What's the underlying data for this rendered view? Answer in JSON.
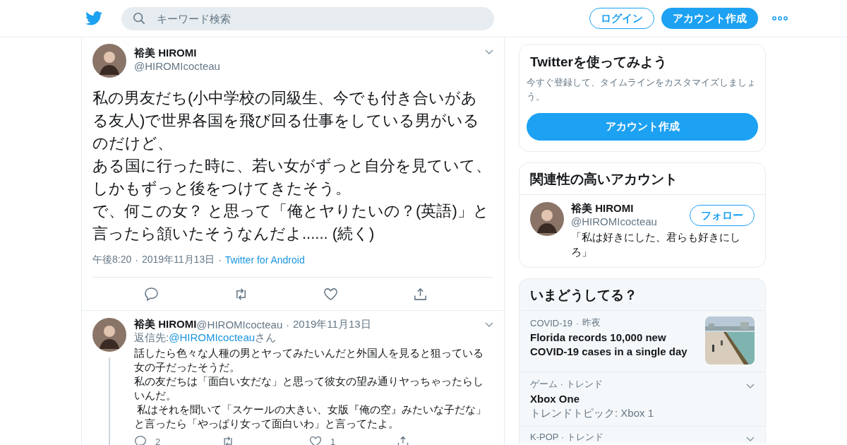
{
  "header": {
    "search": {
      "placeholder": "キーワード検索"
    },
    "login": "ログイン",
    "signup": "アカウント作成"
  },
  "tweet": {
    "name": "裕美 HIROMI",
    "handle": "@HIROMIcocteau",
    "paragraphs": [
      "私の男友だち(小中学校の同級生、今でも付き合いがある友人)で世界各国を飛び回る仕事をしている男がいるのだけど、",
      "ある国に行った時に、若い女がずっと自分を見ていて、しかもずっと後をつけてきたそう。",
      "で、何この女？ と思って「俺とヤりたいの？(英語)」と言ったら頷いたそうなんだよ...... (続く)"
    ],
    "time": "午後8:20",
    "separator": "·",
    "date": "2019年11月13日",
    "separator_2": "·",
    "source": "Twitter for Android"
  },
  "reply": {
    "name": "裕美 HIROMI",
    "handle": "@HIROMIcocteau",
    "separator": "·",
    "date": "2019年11月13日",
    "reply_to_label": "返信先:",
    "reply_to_handle": "@HIROMIcocteau",
    "reply_to_suffix": "さん",
    "paragraphs": [
      "話したら色々な人種の男とヤってみたいんだと外国人を見ると狙っている女の子だったそうだ。",
      "私の友だちは「面白い女だな」と思って彼女の望み通りヤっちゃったらしいんだ。",
      " 私はそれを聞いて「スケールの大きい、女版『俺の空』みたいな子だな」と言ったら「やっぱり女って面白いわ」と言ってたよ。"
    ],
    "reply_count": "2",
    "like_count": "1"
  },
  "signup_card": {
    "title": "Twitterを使ってみよう",
    "text": "今すぐ登録して、タイムラインをカスタマイズしましょう。",
    "button": "アカウント作成"
  },
  "related": {
    "title": "関連性の高いアカウント",
    "account": {
      "name": "裕美 HIROMI",
      "handle": "@HIROMIcocteau",
      "bio": "「私は好きにした、君らも好きにしろ」",
      "follow": "フォロー"
    }
  },
  "trends": {
    "title": "いまどうしてる？",
    "items": [
      {
        "kind": "news",
        "category": "COVID-19",
        "separator": "·",
        "time": "昨夜",
        "title": "Florida records 10,000 new COVID-19 cases in a single day"
      },
      {
        "kind": "trend",
        "category": "ゲーム · トレンド",
        "title": "Xbox One",
        "subtitle": "トレンドトピック: Xbox 1"
      },
      {
        "kind": "trend",
        "category": "K-POP · トレンド"
      }
    ]
  }
}
